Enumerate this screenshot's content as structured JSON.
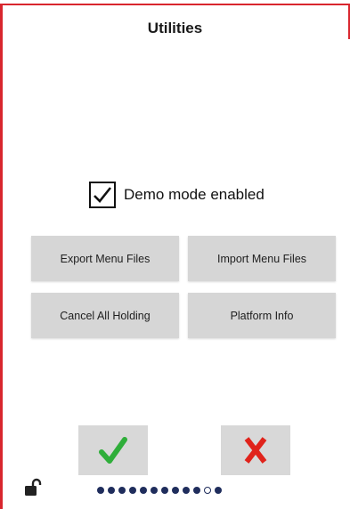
{
  "screen": {
    "title": "Utilities"
  },
  "demo_mode": {
    "label": "Demo mode enabled",
    "checked": true
  },
  "buttons": {
    "export_menu_files": "Export Menu Files",
    "import_menu_files": "Import Menu Files",
    "cancel_all_holding": "Cancel All Holding",
    "platform_info": "Platform Info"
  },
  "actions": {
    "confirm_icon": "green-check-icon",
    "cancel_icon": "red-x-icon"
  },
  "pager": {
    "total": 12,
    "current": 11
  },
  "status": {
    "lock_icon": "unlocked-padlock-icon"
  },
  "colors": {
    "accent_red": "#d9262e",
    "check_green": "#2fae3a",
    "cancel_red": "#e0231b",
    "dot_navy": "#1f2d5c",
    "button_gray": "#d6d6d6"
  }
}
